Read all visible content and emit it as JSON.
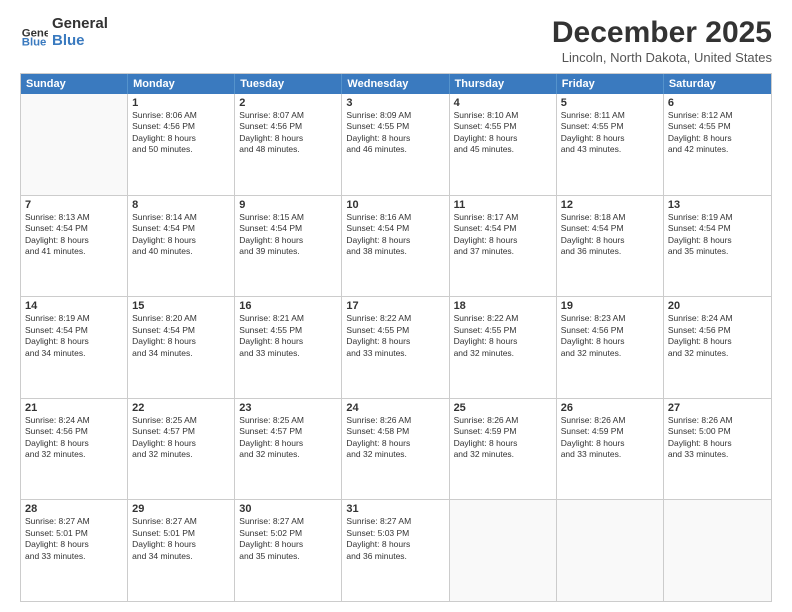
{
  "header": {
    "logo_general": "General",
    "logo_blue": "Blue",
    "month_title": "December 2025",
    "location": "Lincoln, North Dakota, United States"
  },
  "days_of_week": [
    "Sunday",
    "Monday",
    "Tuesday",
    "Wednesday",
    "Thursday",
    "Friday",
    "Saturday"
  ],
  "weeks": [
    [
      {
        "day": "",
        "lines": []
      },
      {
        "day": "1",
        "lines": [
          "Sunrise: 8:06 AM",
          "Sunset: 4:56 PM",
          "Daylight: 8 hours",
          "and 50 minutes."
        ]
      },
      {
        "day": "2",
        "lines": [
          "Sunrise: 8:07 AM",
          "Sunset: 4:56 PM",
          "Daylight: 8 hours",
          "and 48 minutes."
        ]
      },
      {
        "day": "3",
        "lines": [
          "Sunrise: 8:09 AM",
          "Sunset: 4:55 PM",
          "Daylight: 8 hours",
          "and 46 minutes."
        ]
      },
      {
        "day": "4",
        "lines": [
          "Sunrise: 8:10 AM",
          "Sunset: 4:55 PM",
          "Daylight: 8 hours",
          "and 45 minutes."
        ]
      },
      {
        "day": "5",
        "lines": [
          "Sunrise: 8:11 AM",
          "Sunset: 4:55 PM",
          "Daylight: 8 hours",
          "and 43 minutes."
        ]
      },
      {
        "day": "6",
        "lines": [
          "Sunrise: 8:12 AM",
          "Sunset: 4:55 PM",
          "Daylight: 8 hours",
          "and 42 minutes."
        ]
      }
    ],
    [
      {
        "day": "7",
        "lines": [
          "Sunrise: 8:13 AM",
          "Sunset: 4:54 PM",
          "Daylight: 8 hours",
          "and 41 minutes."
        ]
      },
      {
        "day": "8",
        "lines": [
          "Sunrise: 8:14 AM",
          "Sunset: 4:54 PM",
          "Daylight: 8 hours",
          "and 40 minutes."
        ]
      },
      {
        "day": "9",
        "lines": [
          "Sunrise: 8:15 AM",
          "Sunset: 4:54 PM",
          "Daylight: 8 hours",
          "and 39 minutes."
        ]
      },
      {
        "day": "10",
        "lines": [
          "Sunrise: 8:16 AM",
          "Sunset: 4:54 PM",
          "Daylight: 8 hours",
          "and 38 minutes."
        ]
      },
      {
        "day": "11",
        "lines": [
          "Sunrise: 8:17 AM",
          "Sunset: 4:54 PM",
          "Daylight: 8 hours",
          "and 37 minutes."
        ]
      },
      {
        "day": "12",
        "lines": [
          "Sunrise: 8:18 AM",
          "Sunset: 4:54 PM",
          "Daylight: 8 hours",
          "and 36 minutes."
        ]
      },
      {
        "day": "13",
        "lines": [
          "Sunrise: 8:19 AM",
          "Sunset: 4:54 PM",
          "Daylight: 8 hours",
          "and 35 minutes."
        ]
      }
    ],
    [
      {
        "day": "14",
        "lines": [
          "Sunrise: 8:19 AM",
          "Sunset: 4:54 PM",
          "Daylight: 8 hours",
          "and 34 minutes."
        ]
      },
      {
        "day": "15",
        "lines": [
          "Sunrise: 8:20 AM",
          "Sunset: 4:54 PM",
          "Daylight: 8 hours",
          "and 34 minutes."
        ]
      },
      {
        "day": "16",
        "lines": [
          "Sunrise: 8:21 AM",
          "Sunset: 4:55 PM",
          "Daylight: 8 hours",
          "and 33 minutes."
        ]
      },
      {
        "day": "17",
        "lines": [
          "Sunrise: 8:22 AM",
          "Sunset: 4:55 PM",
          "Daylight: 8 hours",
          "and 33 minutes."
        ]
      },
      {
        "day": "18",
        "lines": [
          "Sunrise: 8:22 AM",
          "Sunset: 4:55 PM",
          "Daylight: 8 hours",
          "and 32 minutes."
        ]
      },
      {
        "day": "19",
        "lines": [
          "Sunrise: 8:23 AM",
          "Sunset: 4:56 PM",
          "Daylight: 8 hours",
          "and 32 minutes."
        ]
      },
      {
        "day": "20",
        "lines": [
          "Sunrise: 8:24 AM",
          "Sunset: 4:56 PM",
          "Daylight: 8 hours",
          "and 32 minutes."
        ]
      }
    ],
    [
      {
        "day": "21",
        "lines": [
          "Sunrise: 8:24 AM",
          "Sunset: 4:56 PM",
          "Daylight: 8 hours",
          "and 32 minutes."
        ]
      },
      {
        "day": "22",
        "lines": [
          "Sunrise: 8:25 AM",
          "Sunset: 4:57 PM",
          "Daylight: 8 hours",
          "and 32 minutes."
        ]
      },
      {
        "day": "23",
        "lines": [
          "Sunrise: 8:25 AM",
          "Sunset: 4:57 PM",
          "Daylight: 8 hours",
          "and 32 minutes."
        ]
      },
      {
        "day": "24",
        "lines": [
          "Sunrise: 8:26 AM",
          "Sunset: 4:58 PM",
          "Daylight: 8 hours",
          "and 32 minutes."
        ]
      },
      {
        "day": "25",
        "lines": [
          "Sunrise: 8:26 AM",
          "Sunset: 4:59 PM",
          "Daylight: 8 hours",
          "and 32 minutes."
        ]
      },
      {
        "day": "26",
        "lines": [
          "Sunrise: 8:26 AM",
          "Sunset: 4:59 PM",
          "Daylight: 8 hours",
          "and 33 minutes."
        ]
      },
      {
        "day": "27",
        "lines": [
          "Sunrise: 8:26 AM",
          "Sunset: 5:00 PM",
          "Daylight: 8 hours",
          "and 33 minutes."
        ]
      }
    ],
    [
      {
        "day": "28",
        "lines": [
          "Sunrise: 8:27 AM",
          "Sunset: 5:01 PM",
          "Daylight: 8 hours",
          "and 33 minutes."
        ]
      },
      {
        "day": "29",
        "lines": [
          "Sunrise: 8:27 AM",
          "Sunset: 5:01 PM",
          "Daylight: 8 hours",
          "and 34 minutes."
        ]
      },
      {
        "day": "30",
        "lines": [
          "Sunrise: 8:27 AM",
          "Sunset: 5:02 PM",
          "Daylight: 8 hours",
          "and 35 minutes."
        ]
      },
      {
        "day": "31",
        "lines": [
          "Sunrise: 8:27 AM",
          "Sunset: 5:03 PM",
          "Daylight: 8 hours",
          "and 36 minutes."
        ]
      },
      {
        "day": "",
        "lines": []
      },
      {
        "day": "",
        "lines": []
      },
      {
        "day": "",
        "lines": []
      }
    ]
  ]
}
